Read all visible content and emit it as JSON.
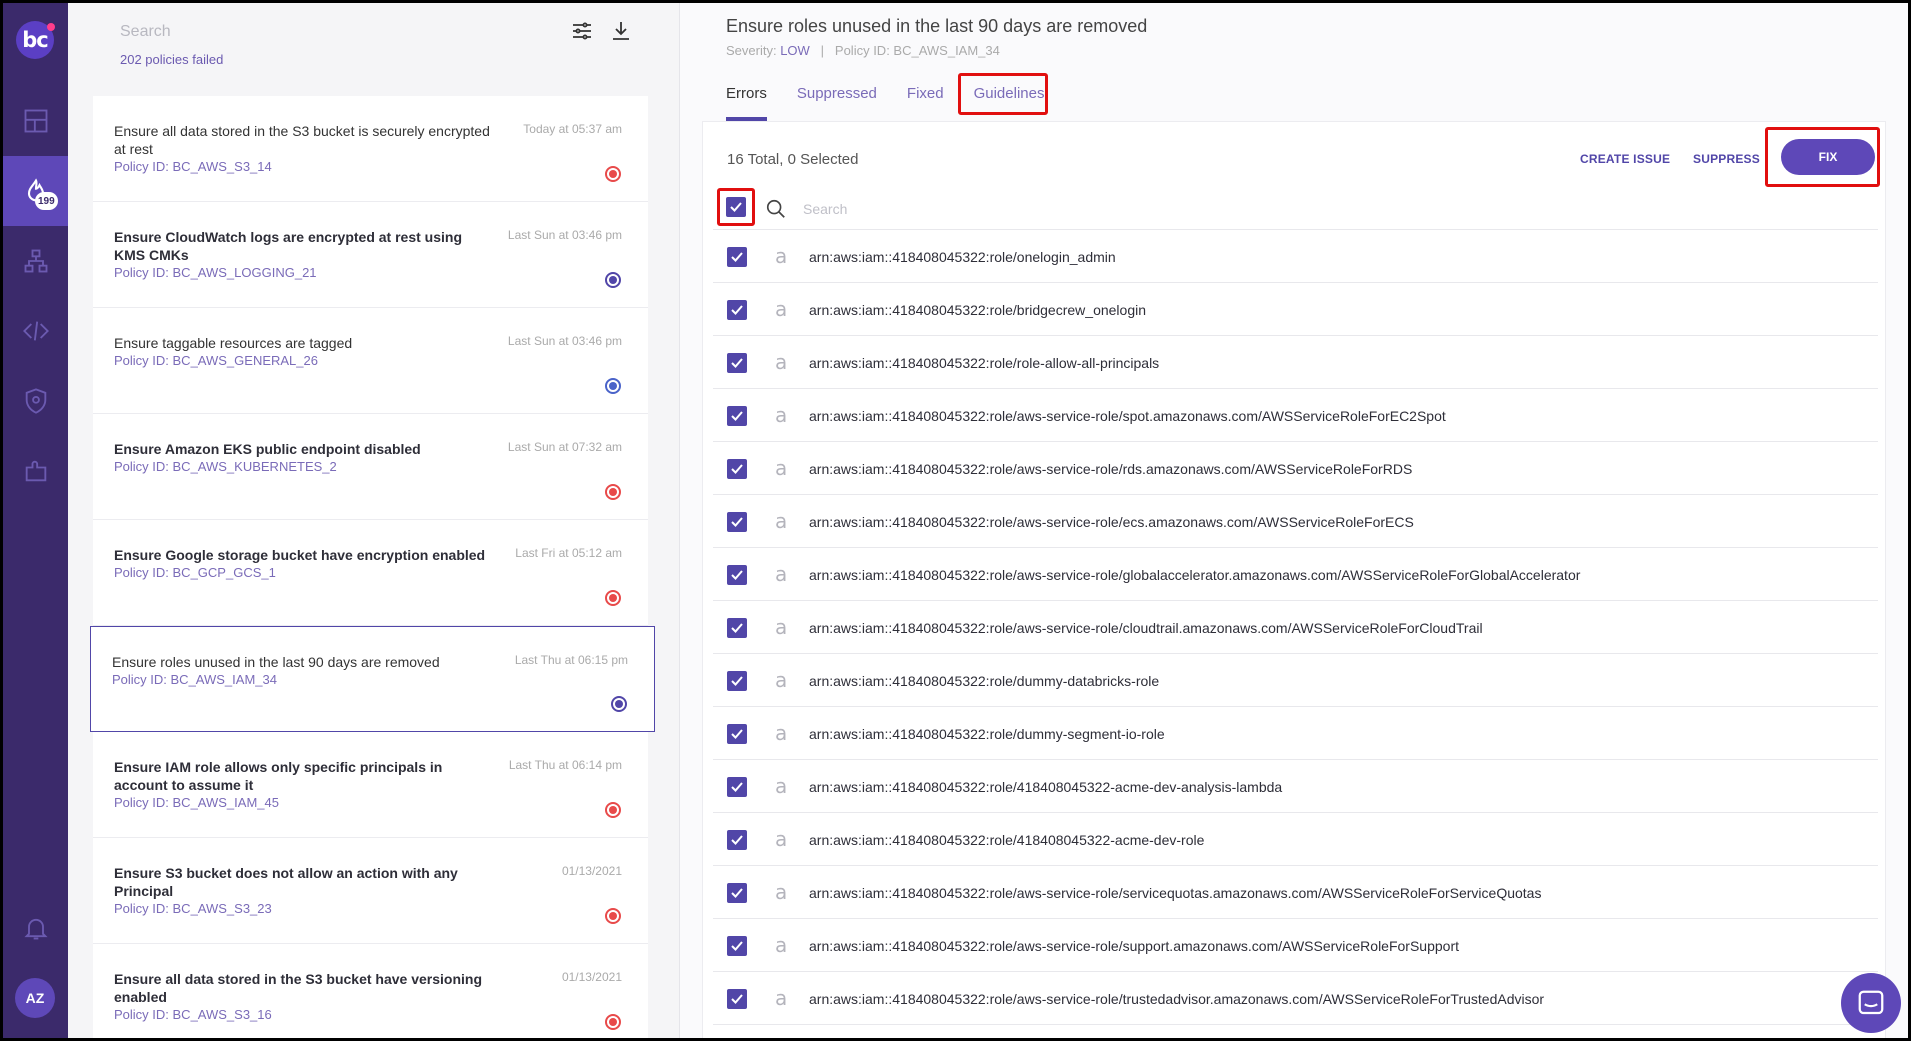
{
  "nav": {
    "logo": "bc",
    "badge": "199",
    "avatar": "AZ",
    "icons": [
      "dashboard-icon",
      "incidents-icon",
      "resources-icon",
      "code-icon",
      "shield-icon",
      "integrations-icon",
      "bell-icon"
    ]
  },
  "list": {
    "search_placeholder": "Search",
    "failed_count": "202 policies failed",
    "items": [
      {
        "title": "Ensure all data stored in the S3 bucket is securely encrypted at rest",
        "policy_id": "Policy ID: BC_AWS_S3_14",
        "time": "Today at 05:37 am",
        "bold": false,
        "severity": "high"
      },
      {
        "title": "Ensure CloudWatch logs are encrypted at rest using KMS CMKs",
        "policy_id": "Policy ID: BC_AWS_LOGGING_21",
        "time": "Last Sun at 03:46 pm",
        "bold": true,
        "severity": "low"
      },
      {
        "title": "Ensure taggable resources are tagged",
        "policy_id": "Policy ID: BC_AWS_GENERAL_26",
        "time": "Last Sun at 03:46 pm",
        "bold": false,
        "severity": "info"
      },
      {
        "title": "Ensure Amazon EKS public endpoint disabled",
        "policy_id": "Policy ID: BC_AWS_KUBERNETES_2",
        "time": "Last Sun at 07:32 am",
        "bold": true,
        "severity": "high"
      },
      {
        "title": "Ensure Google storage bucket have encryption enabled",
        "policy_id": "Policy ID: BC_GCP_GCS_1",
        "time": "Last Fri at 05:12 am",
        "bold": true,
        "severity": "high"
      },
      {
        "title": "Ensure roles unused in the last 90 days are removed",
        "policy_id": "Policy ID: BC_AWS_IAM_34",
        "time": "Last Thu at 06:15 pm",
        "bold": false,
        "severity": "low",
        "selected": true
      },
      {
        "title": "Ensure IAM role allows only specific principals in account to assume it",
        "policy_id": "Policy ID: BC_AWS_IAM_45",
        "time": "Last Thu at 06:14 pm",
        "bold": true,
        "severity": "high"
      },
      {
        "title": "Ensure S3 bucket does not allow an action with any Principal",
        "policy_id": "Policy ID: BC_AWS_S3_23",
        "time": "01/13/2021",
        "bold": true,
        "severity": "high"
      },
      {
        "title": "Ensure all data stored in the S3 bucket have versioning enabled",
        "policy_id": "Policy ID: BC_AWS_S3_16",
        "time": "01/13/2021",
        "bold": true,
        "severity": "high"
      }
    ]
  },
  "detail": {
    "title": "Ensure roles unused in the last 90 days are removed",
    "severity_label": "Severity:",
    "severity": "LOW",
    "policy_id": "Policy ID: BC_AWS_IAM_34",
    "tabs": [
      "Errors",
      "Suppressed",
      "Fixed",
      "Guidelines"
    ],
    "active_tab": "Errors",
    "total": "16 Total, 0 Selected",
    "create_issue": "CREATE ISSUE",
    "suppress": "SUPPRESS",
    "fix": "FIX",
    "search_placeholder": "Search",
    "resources": [
      "arn:aws:iam::418408045322:role/onelogin_admin",
      "arn:aws:iam::418408045322:role/bridgecrew_onelogin",
      "arn:aws:iam::418408045322:role/role-allow-all-principals",
      "arn:aws:iam::418408045322:role/aws-service-role/spot.amazonaws.com/AWSServiceRoleForEC2Spot",
      "arn:aws:iam::418408045322:role/aws-service-role/rds.amazonaws.com/AWSServiceRoleForRDS",
      "arn:aws:iam::418408045322:role/aws-service-role/ecs.amazonaws.com/AWSServiceRoleForECS",
      "arn:aws:iam::418408045322:role/aws-service-role/globalaccelerator.amazonaws.com/AWSServiceRoleForGlobalAccelerator",
      "arn:aws:iam::418408045322:role/aws-service-role/cloudtrail.amazonaws.com/AWSServiceRoleForCloudTrail",
      "arn:aws:iam::418408045322:role/dummy-databricks-role",
      "arn:aws:iam::418408045322:role/dummy-segment-io-role",
      "arn:aws:iam::418408045322:role/418408045322-acme-dev-analysis-lambda",
      "arn:aws:iam::418408045322:role/418408045322-acme-dev-role",
      "arn:aws:iam::418408045322:role/aws-service-role/servicequotas.amazonaws.com/AWSServiceRoleForServiceQuotas",
      "arn:aws:iam::418408045322:role/aws-service-role/support.amazonaws.com/AWSServiceRoleForSupport",
      "arn:aws:iam::418408045322:role/aws-service-role/trustedadvisor.amazonaws.com/AWSServiceRoleForTrustedAdvisor"
    ],
    "resource_icon": "amazon-icon"
  },
  "colors": {
    "nav_bg": "#3b2a6b",
    "accent": "#5146a8",
    "severity_high": "#e84a4a",
    "severity_low": "#5146a8",
    "severity_info": "#4a63c9",
    "highlight_box": "#e10f0f"
  }
}
